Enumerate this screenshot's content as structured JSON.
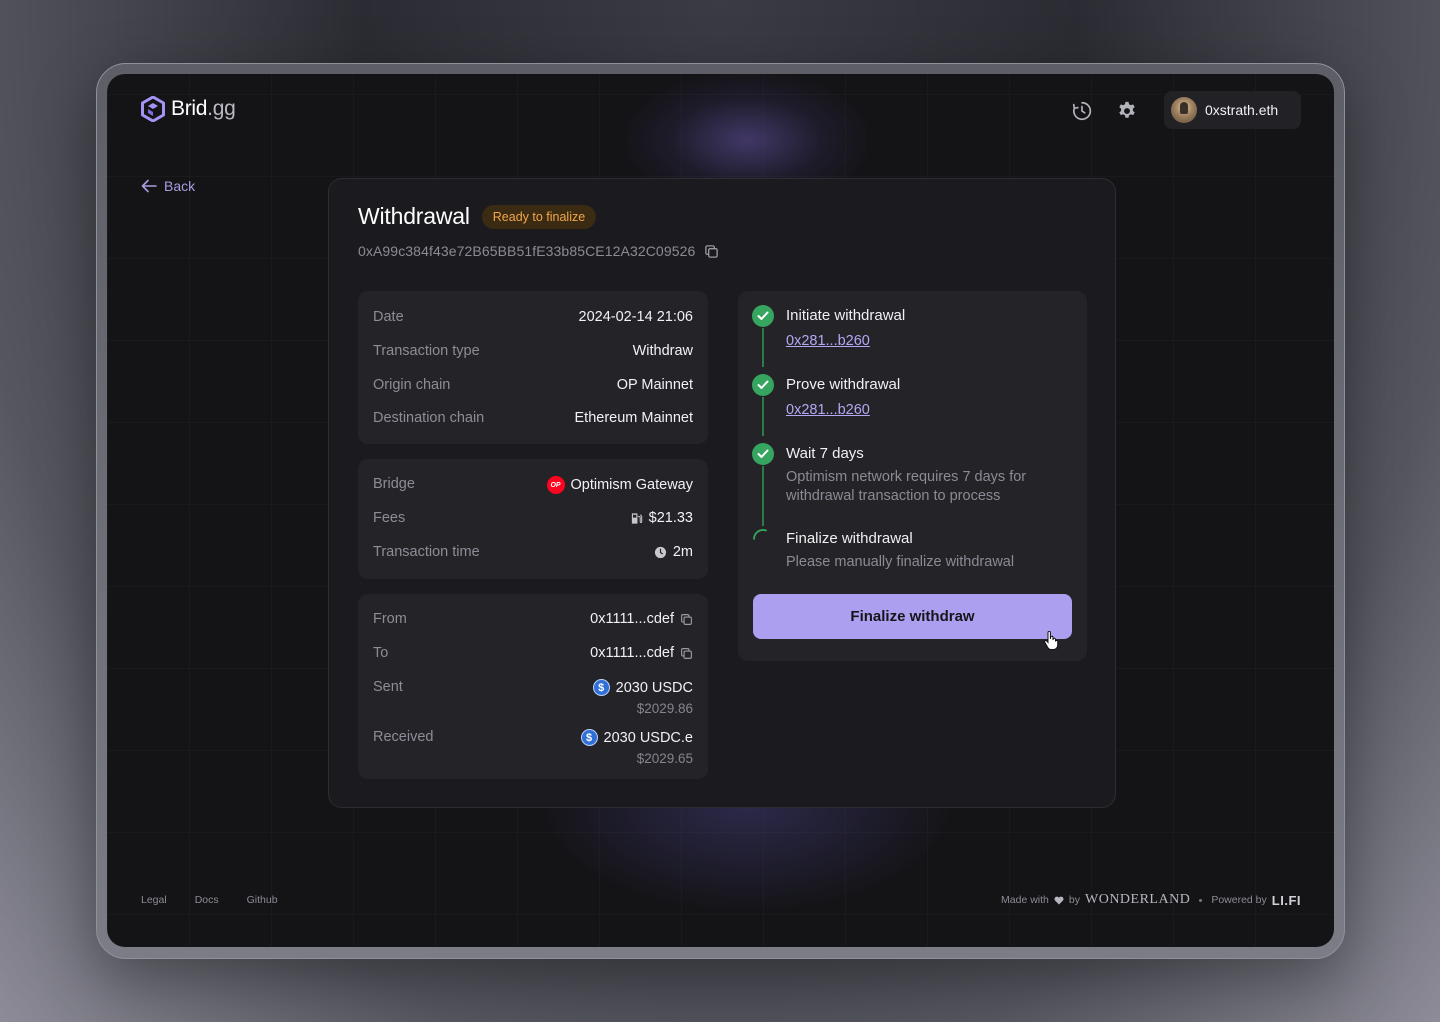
{
  "app": {
    "brand_main": "Brid",
    "brand_suffix": ".gg"
  },
  "header": {
    "user_name": "0xstrath.eth",
    "icons": [
      "history-icon",
      "gear-icon"
    ]
  },
  "nav": {
    "back_label": "Back"
  },
  "withdrawal": {
    "title": "Withdrawal",
    "status": "Ready to finalize",
    "tx_hash": "0xA99c384f43e72B65BB51fE33b85CE12A32C09526"
  },
  "details": {
    "date_label": "Date",
    "date_value": "2024-02-14 21:06",
    "type_label": "Transaction type",
    "type_value": "Withdraw",
    "origin_label": "Origin chain",
    "origin_value": "OP Mainnet",
    "dest_label": "Destination chain",
    "dest_value": "Ethereum Mainnet"
  },
  "bridge_info": {
    "bridge_label": "Bridge",
    "bridge_value": "Optimism Gateway",
    "bridge_logo": "OP",
    "fees_label": "Fees",
    "fees_value": "$21.33",
    "time_label": "Transaction time",
    "time_value": "2m"
  },
  "transfer": {
    "from_label": "From",
    "from_value": "0x1111...cdef",
    "to_label": "To",
    "to_value": "0x1111...cdef",
    "sent_label": "Sent",
    "sent_amount": "2030 USDC",
    "sent_usd": "$2029.86",
    "received_label": "Received",
    "received_amount": "2030 USDC.e",
    "received_usd": "$2029.65",
    "coin_symbol": "$"
  },
  "steps": [
    {
      "title": "Initiate withdrawal",
      "link": "0x281...b260",
      "status": "done"
    },
    {
      "title": "Prove withdrawal",
      "link": "0x281...b260",
      "status": "done"
    },
    {
      "title": "Wait 7 days",
      "desc": "Optimism network requires 7 days for withdrawal transaction to process",
      "status": "done"
    },
    {
      "title": "Finalize withdrawal",
      "desc": "Please manually finalize withdrawal",
      "status": "pending"
    }
  ],
  "finalize_button": "Finalize withdraw",
  "footer": {
    "links": [
      "Legal",
      "Docs",
      "Github"
    ],
    "made_with": "Made with",
    "by": "by",
    "wonderland": "WONDERLAND",
    "powered_by": "Powered by",
    "lifi": "LI.FI"
  },
  "colors": {
    "accent": "#ad9ff0",
    "success": "#36a560",
    "status_badge": "#f3a64a",
    "background": "#141417"
  }
}
